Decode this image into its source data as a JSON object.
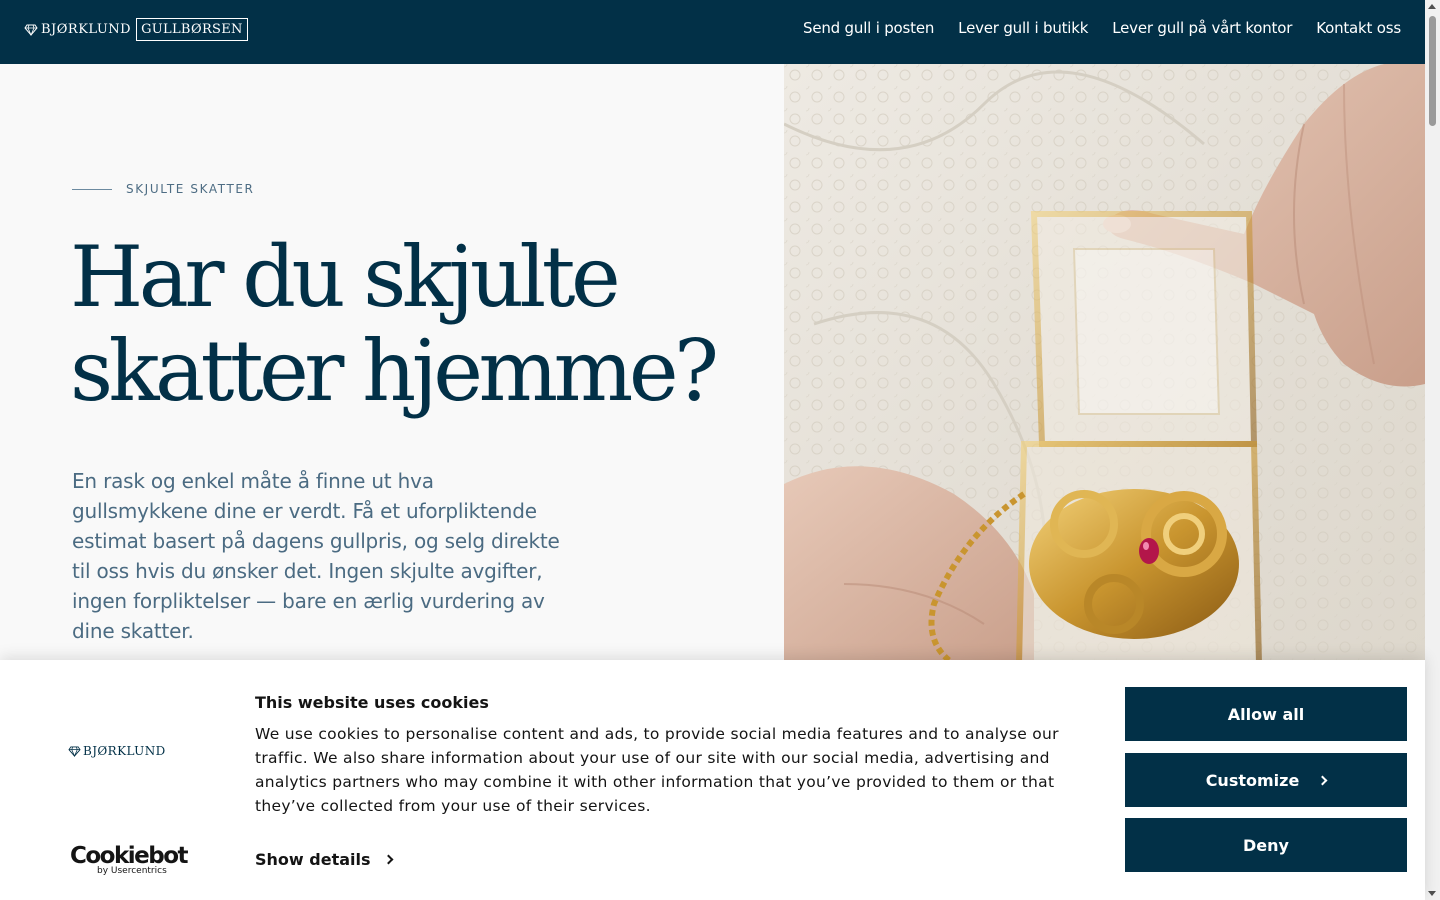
{
  "header": {
    "logo": {
      "brand": "BJØRKLUND",
      "boxed": "GULLBØRSEN"
    },
    "nav": [
      {
        "label": "Send gull i posten"
      },
      {
        "label": "Lever gull i butikk"
      },
      {
        "label": "Lever gull på vårt kontor"
      },
      {
        "label": "Kontakt oss"
      }
    ]
  },
  "hero": {
    "eyebrow": "SKJULTE SKATTER",
    "headline_line1": "Har du skjulte",
    "headline_line2": "skatter hjemme?",
    "lead": "En rask og enkel måte å finne ut hva gullsmykkene dine er verdt. Få et uforpliktende estimat basert på dagens gullpris, og selg direkte til oss hvis du ønsker det. Ingen skjulte avgifter, ingen forpliktelser — bare en ærlig vurdering av dine skatter."
  },
  "cookie_banner": {
    "logo_brand": "BJØRKLUND",
    "title": "This website uses cookies",
    "text": "We use cookies to personalise content and ads, to provide social media features and to analyse our traffic. We also share information about your use of our site with our social media, advertising and analytics partners who may combine it with other information that you’ve provided to them or that they’ve collected from your use of their services.",
    "show_details": "Show details",
    "provider_name": "Cookiebot",
    "provider_sub": "by Usercentrics",
    "buttons": {
      "allow": "Allow all",
      "customize": "Customize",
      "deny": "Deny"
    }
  },
  "colors": {
    "brand_navy": "#023047",
    "lead_text": "#4b6b82",
    "page_bg": "#f9f9f9"
  },
  "icons": [
    "diamond-icon",
    "chevron-right-icon"
  ]
}
